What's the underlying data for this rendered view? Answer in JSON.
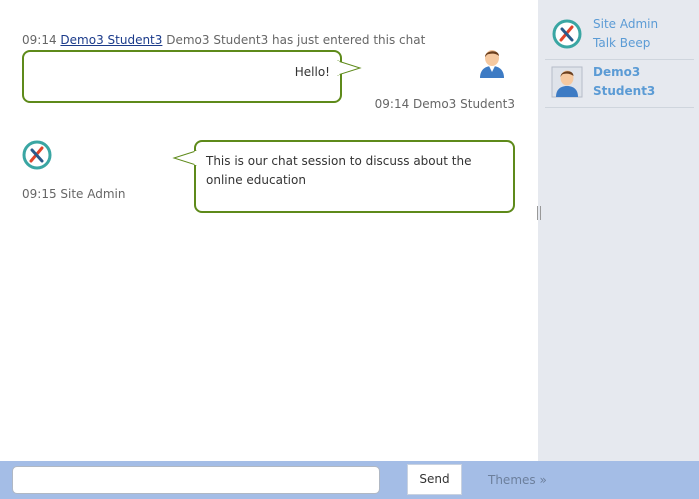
{
  "chat": {
    "system_message": {
      "time": "09:14",
      "user_link": "Demo3 Student3",
      "text": "Demo3 Student3 has just entered this chat"
    },
    "messages": [
      {
        "text": "Hello!",
        "meta": "09:14 Demo3 Student3"
      },
      {
        "text": "This is our chat session to discuss about the online education",
        "meta": "09:15 Site Admin"
      }
    ]
  },
  "sidebar": {
    "users": [
      {
        "name_line1": "Site Admin",
        "name_line2": "Talk Beep"
      },
      {
        "name_line1": "Demo3",
        "name_line2": "Student3"
      }
    ]
  },
  "footer": {
    "input_value": "",
    "send_label": "Send",
    "themes_label": "Themes »"
  },
  "colors": {
    "bubble_border": "#5e8a1a",
    "sidebar_bg": "#e6e9ef",
    "bottom_bar_bg": "#a4bde6",
    "user_name": "#5b9bd5",
    "link": "#1a3a8a"
  },
  "icons": {
    "student_avatar": "student-avatar-icon",
    "admin_logo": "talkbeep-logo-icon"
  }
}
